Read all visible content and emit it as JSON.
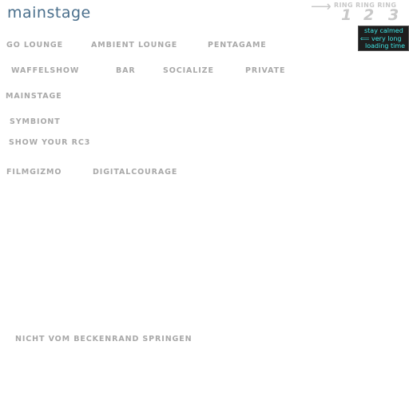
{
  "header": {
    "logo_text": "mainstage",
    "ring_arrow": "⟶",
    "ring_text": "RING RING RING",
    "ring_numbers": [
      "1",
      "2",
      "3"
    ]
  },
  "loading_notice": {
    "lines": [
      "stay calmed",
      "very long",
      "loading time"
    ],
    "arrow": "⟸"
  },
  "nav": {
    "go_lounge": "GO LOUNGE",
    "ambient_lounge": "AMBIENT LOUNGE",
    "pentagame": "PENTAGAME",
    "waffelshow": "WAFFELSHOW",
    "bar": "BAR",
    "socialize": "SOCIALIZE",
    "private": "PRIVATE",
    "mainstage": "MAINSTAGE",
    "symbiont": "SYMBIONT",
    "show_your_rc3": "SHOW YOUR RC3",
    "filmgizmo": "FILMGIZMO",
    "digitalcourage": "DIGITALCOURAGE",
    "nicht_vom_beckenrand": "NICHT VOM BECKENRAND SPRINGEN"
  },
  "colors": {
    "logo": "#4a6f8c",
    "nav_text": "#a9a9a9",
    "ring": "#c8c8c8",
    "loading_bg": "#1e1e1e",
    "loading_text": "#3ee6e6"
  }
}
